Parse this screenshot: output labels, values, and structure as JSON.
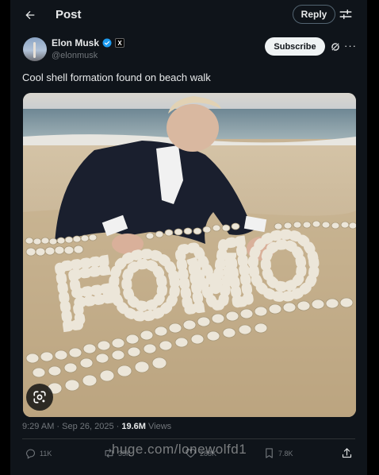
{
  "header": {
    "title": "Post",
    "reply_label": "Reply"
  },
  "author": {
    "name": "Elon Musk",
    "handle": "@elonmusk",
    "badge": "X"
  },
  "subscribe_label": "Subscribe",
  "more_label": "···",
  "tweet": {
    "text": "Cool shell formation found on beach walk"
  },
  "meta": {
    "timestamp": "9:29 AM · Sep 26, 2025 · ",
    "views_count": "19.6M",
    "views_label": " Views"
  },
  "actions": {
    "replies": "11K",
    "reposts": "35K",
    "likes": "288K",
    "bookmarks": "7.8K"
  },
  "watermark": "huge.com/lonewolfd1",
  "photo": {
    "shell_text": "FOMO"
  },
  "icons": {
    "back": "arrow-left-icon",
    "settings": "sliders-icon",
    "verified": "verified-badge-icon",
    "grok": "grok-icon",
    "lens": "google-lens-icon",
    "reply": "comment-icon",
    "repost": "repost-icon",
    "like": "heart-icon",
    "bookmark": "bookmark-icon",
    "share": "share-icon"
  },
  "colors": {
    "background": "#0f141a",
    "verified": "#1d9bf0",
    "muted": "#71767b",
    "text": "#e7e9ea"
  }
}
